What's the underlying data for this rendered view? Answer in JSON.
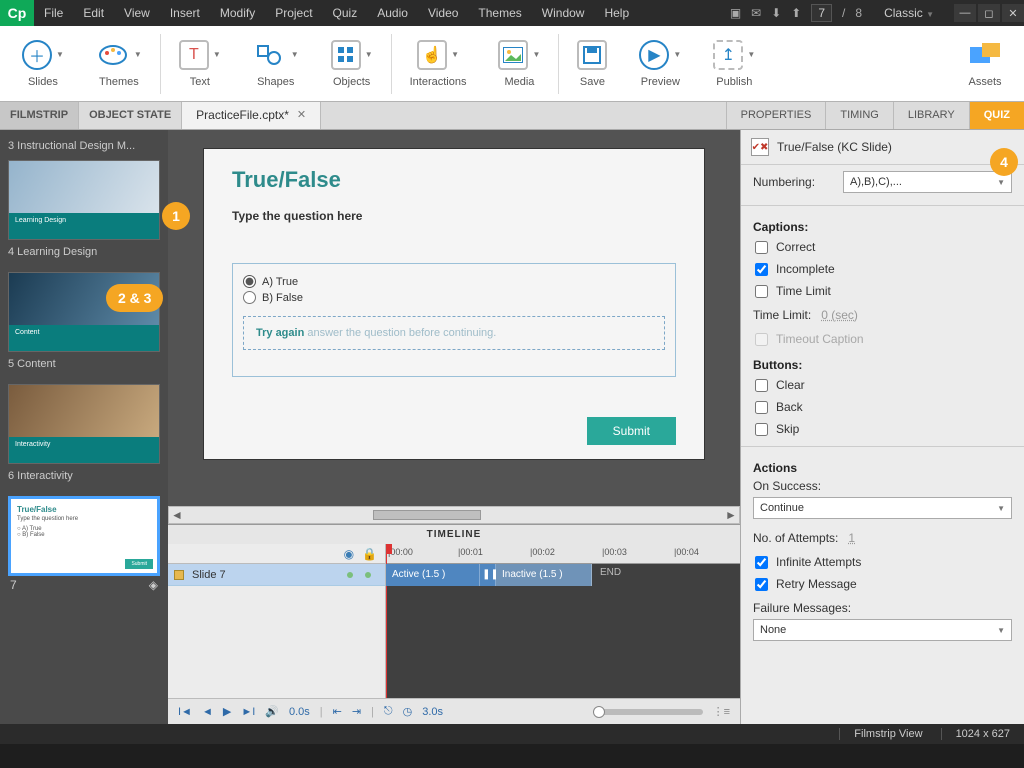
{
  "app": {
    "logo": "Cp",
    "layout": "Classic"
  },
  "menu": [
    "File",
    "Edit",
    "View",
    "Insert",
    "Modify",
    "Project",
    "Quiz",
    "Audio",
    "Video",
    "Themes",
    "Window",
    "Help"
  ],
  "paging": {
    "current": "7",
    "sep": "/",
    "total": "8"
  },
  "ribbon": {
    "slides": "Slides",
    "themes": "Themes",
    "text": "Text",
    "shapes": "Shapes",
    "objects": "Objects",
    "interactions": "Interactions",
    "media": "Media",
    "save": "Save",
    "preview": "Preview",
    "publish": "Publish",
    "assets": "Assets"
  },
  "tabs": {
    "filmstrip": "FILMSTRIP",
    "objstate": "OBJECT STATE",
    "doc": "PracticeFile.cptx*",
    "properties": "PROPERTIES",
    "timing": "TIMING",
    "library": "LIBRARY",
    "quiz": "QUIZ"
  },
  "filmstrip": {
    "items": [
      {
        "label": "3 Instructional Design M...",
        "bar": ""
      },
      {
        "label": "4 Learning Design",
        "bar": "Learning Design"
      },
      {
        "label": "5 Content",
        "bar": "Content"
      },
      {
        "label": "6 Interactivity",
        "bar": "Interactivity"
      },
      {
        "label": "7",
        "bar": ""
      }
    ]
  },
  "stage": {
    "title": "True/False",
    "question": "Type the question here",
    "optA": "A) True",
    "optB": "B) False",
    "tryagain_label": "Try again",
    "tryagain_msg": "answer the question before continuing.",
    "submit": "Submit"
  },
  "callouts": {
    "c1": "1",
    "c23": "2 & 3",
    "c4": "4"
  },
  "timeline": {
    "title": "TIMELINE",
    "row": "Slide 7",
    "ticks": [
      "|00:00",
      "|00:01",
      "|00:02",
      "|00:03",
      "|00:04"
    ],
    "active": "Active (1.5 )",
    "inactive": "Inactive (1.5 )",
    "end": "END",
    "footer": {
      "elapsed": "0.0s",
      "total": "3.0s"
    }
  },
  "quiz": {
    "name": "True/False (KC Slide)",
    "numbering_label": "Numbering:",
    "numbering_value": "A),B),C),...",
    "captions_section": "Captions:",
    "correct": "Correct",
    "incomplete": "Incomplete",
    "timelimit_chk": "Time Limit",
    "timelimit_label": "Time Limit:",
    "timelimit_value": "0 (sec)",
    "timeout": "Timeout Caption",
    "buttons_section": "Buttons:",
    "clear": "Clear",
    "back": "Back",
    "skip": "Skip",
    "actions_section": "Actions",
    "onsuccess_label": "On Success:",
    "onsuccess_value": "Continue",
    "attempts_label": "No. of Attempts:",
    "attempts_value": "1",
    "infinite": "Infinite Attempts",
    "retry": "Retry Message",
    "failure_label": "Failure Messages:",
    "failure_value": "None"
  },
  "status": {
    "view": "Filmstrip View",
    "dims": "1024 x 627"
  }
}
